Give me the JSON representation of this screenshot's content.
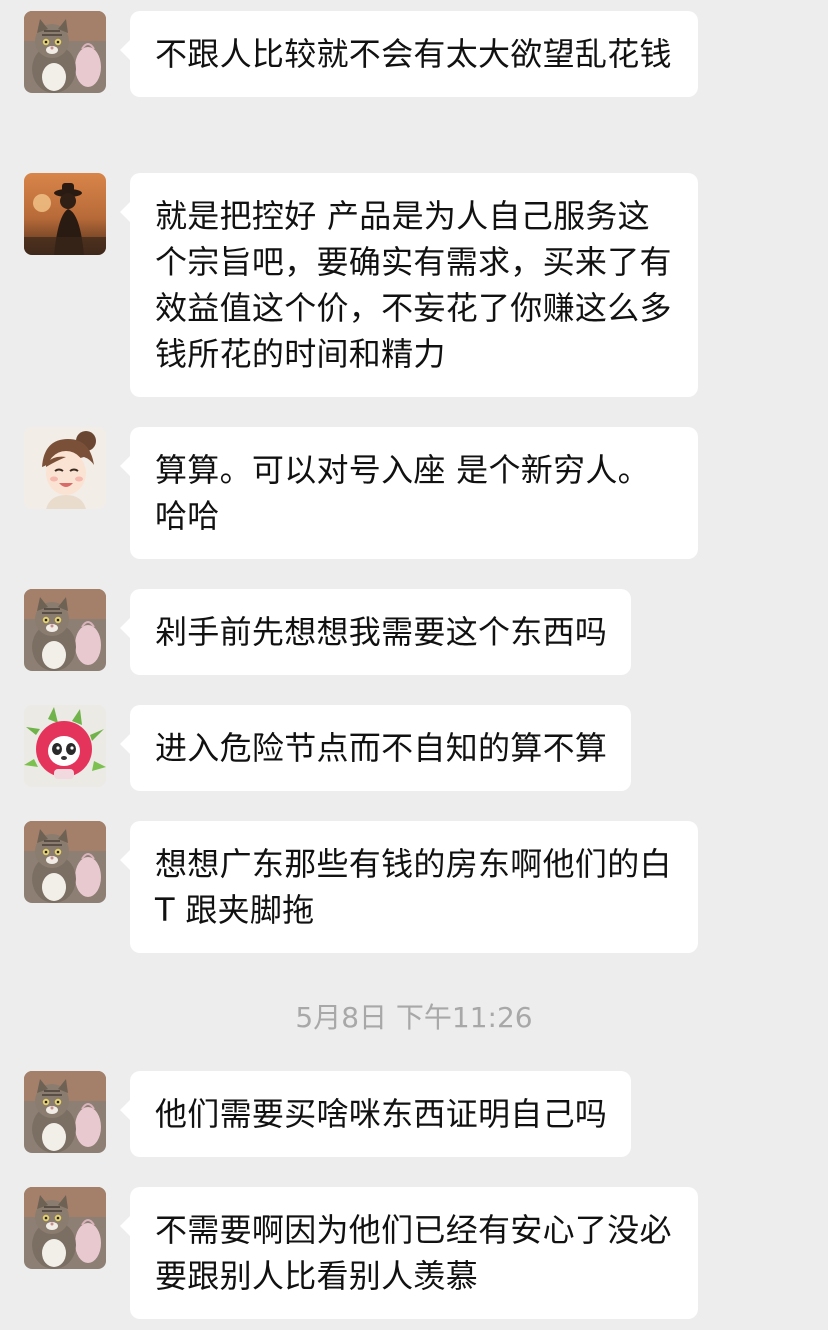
{
  "messages": [
    {
      "avatar": "cat-avatar",
      "text": "不跟人比较就不会有太大欲望乱花钱"
    },
    {
      "avatar": "silhouette-avatar",
      "text": "就是把控好 产品是为人自己服务这个宗旨吧，要确实有需求，买来了有效益值这个价，不妄花了你赚这么多钱所花的时间和精力"
    },
    {
      "avatar": "girl-avatar",
      "text": "算算。可以对号入座 是个新穷人。哈哈"
    },
    {
      "avatar": "cat-avatar",
      "text": "剁手前先想想我需要这个东西吗"
    },
    {
      "avatar": "dragonfruit-avatar",
      "text": "进入危险节点而不自知的算不算"
    },
    {
      "avatar": "cat-avatar",
      "text": "想想广东那些有钱的房东啊他们的白T 跟夹脚拖"
    },
    {
      "avatar": "cat-avatar",
      "text": "他们需要买啥咪东西证明自己吗"
    },
    {
      "avatar": "cat-avatar",
      "text": "不需要啊因为他们已经有安心了没必要跟别人比看别人羡慕"
    }
  ],
  "timestamp": "5月8日 下午11:26",
  "colors": {
    "background": "#ededed",
    "bubble": "#ffffff",
    "text": "#111111",
    "timestamp": "#a8a8a8"
  }
}
